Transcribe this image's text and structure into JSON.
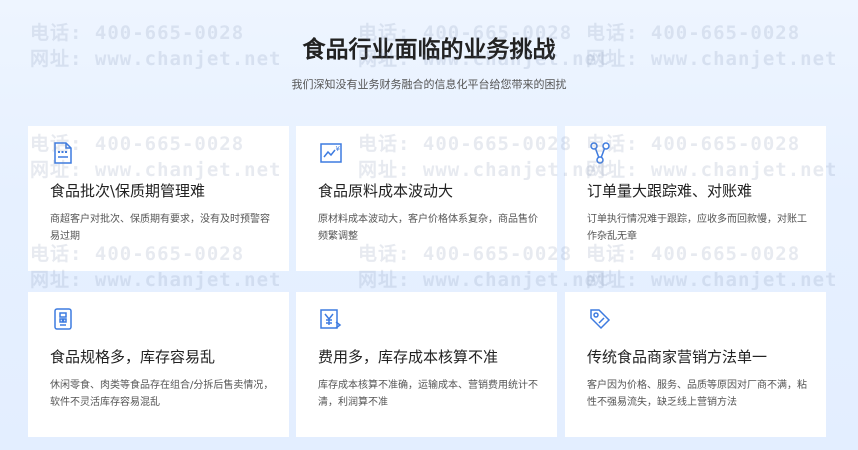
{
  "header": {
    "title": "食品行业面临的业务挑战",
    "subtitle": "我们深知没有业务财务融合的信息化平台给您带来的困扰"
  },
  "cards": [
    {
      "icon": "document-list-icon",
      "title": "食品批次\\保质期管理难",
      "desc": "商超客户对批次、保质期有要求，没有及时预警容易过期"
    },
    {
      "icon": "cost-chart-icon",
      "title": "食品原料成本波动大",
      "desc": "原材料成本波动大，客户价格体系复杂，商品售价频繁调整"
    },
    {
      "icon": "network-nodes-icon",
      "title": "订单量大跟踪难、对账难",
      "desc": "订单执行情况难于跟踪，应收多而回款慢，对账工作杂乱无章"
    },
    {
      "icon": "inventory-grid-icon",
      "title": "食品规格多，库存容易乱",
      "desc": "休闲零食、肉类等食品存在组合/分拆后售卖情况，软件不灵活库存容易混乱"
    },
    {
      "icon": "yen-arrow-icon",
      "title": "费用多，库存成本核算不准",
      "desc": "库存成本核算不准确，运输成本、营销费用统计不清，利润算不准"
    },
    {
      "icon": "price-tag-icon",
      "title": "传统食品商家营销方法单一",
      "desc": "客户因为价格、服务、品质等原因对厂商不满，粘性不强易流失，缺乏线上营销方法"
    }
  ],
  "watermark": {
    "phone": "电话: 400-665-0028",
    "site": "网址: www.chanjet.net"
  },
  "colors": {
    "accent": "#3d7be0",
    "title": "#222222",
    "background": "#e6f0ff"
  }
}
